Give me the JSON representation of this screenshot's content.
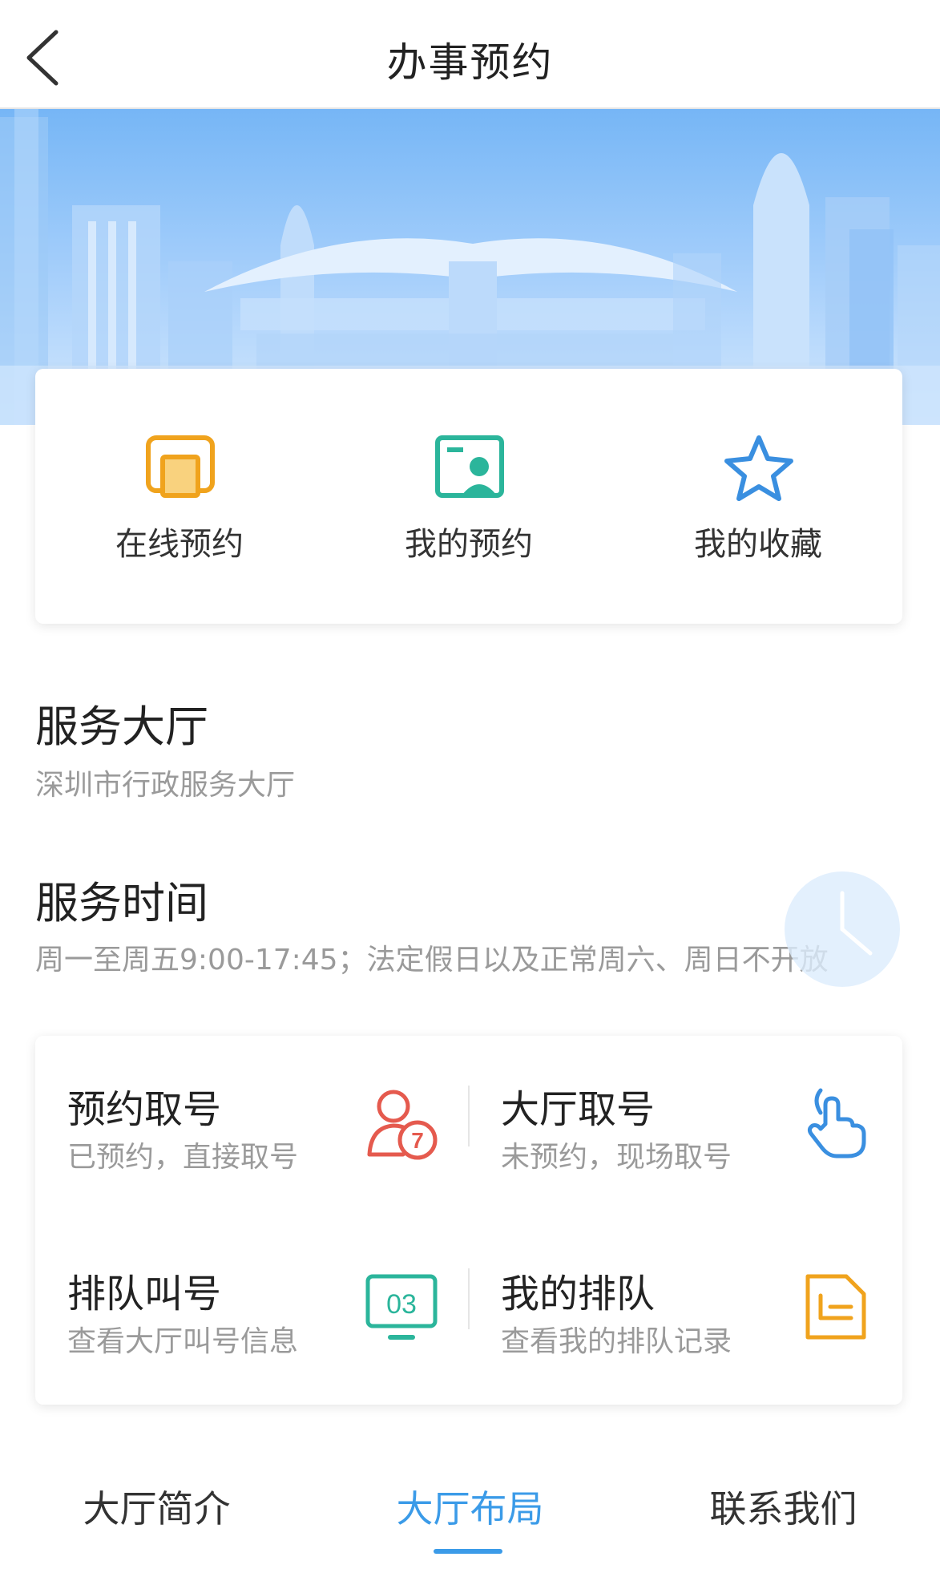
{
  "header": {
    "title": "办事预约"
  },
  "quick_actions": [
    {
      "label": "在线预约",
      "icon": "window-icon",
      "color": "#f0a31d"
    },
    {
      "label": "我的预约",
      "icon": "id-card-icon",
      "color": "#2bb59b"
    },
    {
      "label": "我的收藏",
      "icon": "star-icon",
      "color": "#3a8fe0"
    }
  ],
  "hall": {
    "title": "服务大厅",
    "name": "深圳市行政服务大厅"
  },
  "hours": {
    "title": "服务时间",
    "text": "周一至周五9:00-17:45；法定假日以及正常周六、周日不开放"
  },
  "services": [
    {
      "title": "预约取号",
      "desc": "已预约，直接取号",
      "icon": "person-number-icon",
      "icon_text": "7",
      "color": "#e55a4e"
    },
    {
      "title": "大厅取号",
      "desc": "未预约，现场取号",
      "icon": "hand-tap-icon",
      "color": "#3a8fe0"
    },
    {
      "title": "排队叫号",
      "desc": "查看大厅叫号信息",
      "icon": "monitor-icon",
      "icon_text": "03",
      "color": "#2bb59b"
    },
    {
      "title": "我的排队",
      "desc": "查看我的排队记录",
      "icon": "document-icon",
      "color": "#f0a31d"
    }
  ],
  "tabs": [
    {
      "label": "大厅简介",
      "active": false
    },
    {
      "label": "大厅布局",
      "active": true
    },
    {
      "label": "联系我们",
      "active": false
    }
  ],
  "colors": {
    "accent": "#3b9be8"
  }
}
